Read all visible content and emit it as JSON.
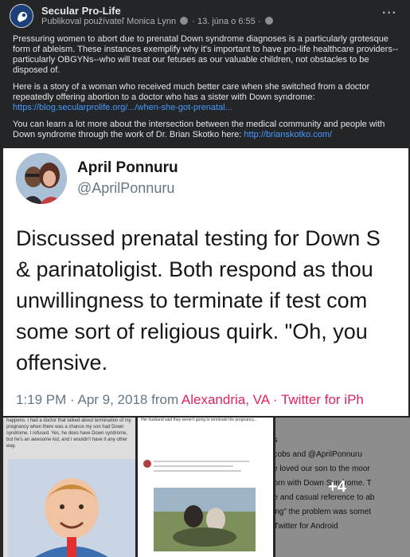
{
  "post": {
    "page_name": "Secular Pro-Life",
    "meta_prefix": "Publikoval používateľ Monica Lynn",
    "meta_sep": "·",
    "date": "13. júna o 6:55",
    "more_glyph": "···",
    "paragraph1": "Pressuring women to abort due to prenatal Down syndrome diagnoses is a particularly grotesque form of ableism. These instances exemplify why it's important to have pro-life healthcare providers--particularly OBGYNs--who will treat our fetuses as our valuable children, not obstacles to be disposed of.",
    "paragraph2_text": "Here is a story of a woman who received much better care when she switched from a doctor repeatedly offering abortion to a doctor who has a sister with Down syndrome:",
    "paragraph2_link": "https://blog.secularprolife.org/.../when-she-got-prenatal...",
    "paragraph3_text": "You can learn a lot more about the intersection between the medical community and people with Down syndrome through the work of Dr. Brian Skotko here:",
    "paragraph3_link": "http://brianskotko.com/"
  },
  "tweet": {
    "name": "April Ponnuru",
    "handle": "@AprilPonnuru",
    "lines": [
      "Discussed prenatal testing for Down S",
      "& parinatoligist. Both respond as thou",
      "unwillingness to terminate if test com",
      "some sort of religious quirk. \"Oh, you",
      "offensive."
    ],
    "time": "1:19 PM · Apr 9, 2018 from",
    "location": "Alexandria, VA · Twitter for iPh"
  },
  "gallery": {
    "img1_text": "happens. I had a doctor that talked about termination of my pregnancy when there was a chance my son had Down syndrome. I refused. Yes, he does have Down syndrome, but he's an awesome kid, and I wouldn't have it any other way.",
    "img2_text": "Her husband said they weren't going to terminate the pregnancy...",
    "img3_lines": [
      "bs",
      "acobs and @AprilPonnuru",
      "ve loved our son to the moor",
      "born with Down Syndrome. T",
      "de and casual reference to ab",
      "king\" the problem was somet",
      "- Twitter for Android"
    ],
    "more_count": "+4"
  },
  "colors": {
    "background": "#242526",
    "link": "#4599ff",
    "tweet_accent": "#e0245e"
  }
}
